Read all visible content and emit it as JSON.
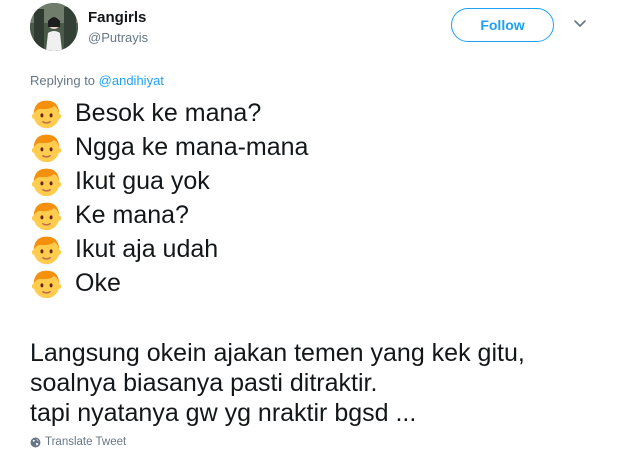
{
  "tweet": {
    "author_name": "Fangirls",
    "author_handle": "@Putrayis",
    "follow_label": "Follow",
    "reply_prefix": "Replying to",
    "reply_target": "@andihiyat",
    "conversation": [
      {
        "text": "Besok ke mana?",
        "icon": "boy-emoji-icon"
      },
      {
        "text": "Ngga ke mana-mana",
        "icon": "boy-emoji-icon"
      },
      {
        "text": "Ikut gua yok",
        "icon": "boy-emoji-icon"
      },
      {
        "text": "Ke mana?",
        "icon": "boy-emoji-icon"
      },
      {
        "text": "Ikut aja udah",
        "icon": "boy-emoji-icon"
      },
      {
        "text": "Oke",
        "icon": "boy-emoji-icon"
      }
    ],
    "body_lines": [
      "Langsung okein ajakan temen yang kek gitu,",
      "soalnya biasanya pasti ditraktir.",
      "tapi nyatanya gw yg nraktir bgsd ..."
    ],
    "translate_label": "Translate Tweet"
  },
  "colors": {
    "accent": "#1da1f2",
    "text": "#14171a",
    "secondary_text": "#657786",
    "emoji_face": "#ffcc4d",
    "emoji_hair": "#f4900c"
  }
}
